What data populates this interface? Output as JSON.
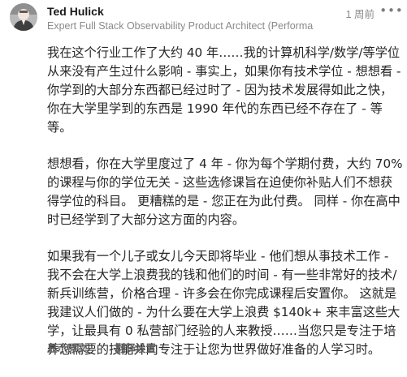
{
  "author": {
    "name": "Ted Hulick",
    "credential": "Expert Full Stack Observability Product Architect (Performa"
  },
  "timestamp": "1 周前",
  "more_menu_icon": "more-horizontal-icon",
  "avatar_icon": "user-avatar-photo",
  "paragraphs": [
    "我在这个行业工作了大约 40 年……我的计算机科学/数学/等学位从来没有产生过什么影响 - 事实上，如果你有技术学位 - 想想看 - 你学到的大部分东西都已经过时了 - 因为技术发展得如此之快，你在大学里学到的东西是 1990 年代的东西已经不存在了 - 等等。",
    "想想看，你在大学里度过了 4 年 - 你为每个学期付费，大约 70% 的课程与你的学位无关 - 这些选修课旨在迫使你补贴人们不想获得学位的科目。 更糟糕的是 - 您正在为此付费。 同样 - 你在高中时已经学到了大部分这方面的内容。",
    "如果我有一个儿子或女儿今天即将毕业 - 他们想从事技术工作 - 我不会在大学上浪费我的钱和他们的时间 - 有一些非常好的技术/新兵训练营，价格合理 - 许多会在你完成课程后安置你。 这就是我建议人们做的 - 为什么要在大学上浪费 $140k+ 来丰富这些大学，让最具有 0 私营部门经验的人来教授……当您只是专注于培养您需要的技能并向专注于让您为世界做好准备的人学习时。"
  ],
  "footer": {
    "show_original": "显示原文",
    "separator": "·",
    "translation_settings": "翻译设置"
  },
  "colors": {
    "text": "#262626",
    "meta": "#8a8a8a",
    "footer": "#5f5f5f"
  }
}
